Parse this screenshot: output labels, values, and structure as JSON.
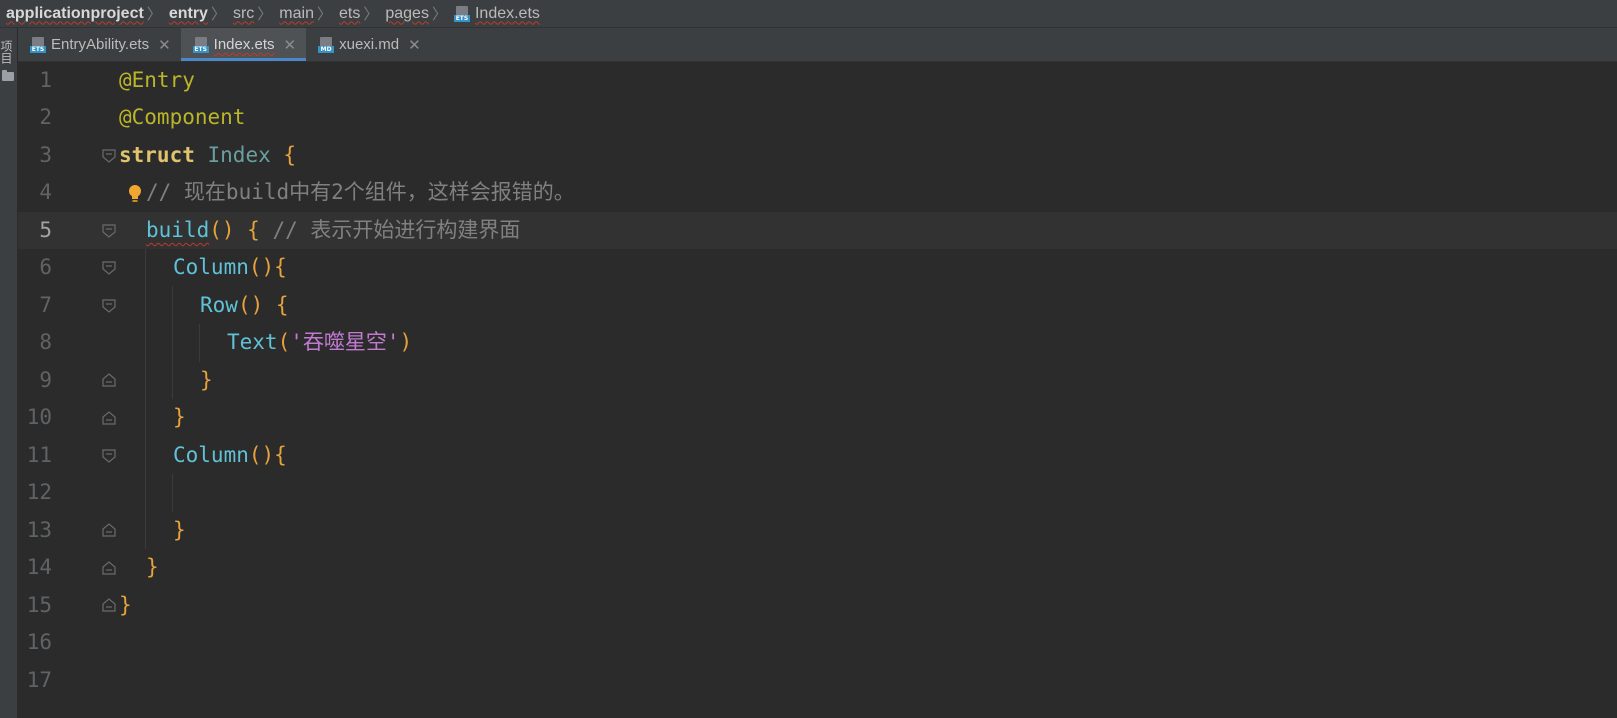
{
  "breadcrumb": {
    "items": [
      "applicationproject",
      "entry",
      "src",
      "main",
      "ets",
      "pages",
      "Index.ets"
    ]
  },
  "side_strip": {
    "label": "项目"
  },
  "tabs": [
    {
      "label": "EntryAbility.ets",
      "icon": "ETS",
      "active": false
    },
    {
      "label": "Index.ets",
      "icon": "ETS",
      "active": true
    },
    {
      "label": "xuexi.md",
      "icon": "MD",
      "active": false
    }
  ],
  "editor": {
    "current_line": 5,
    "line_numbers": [
      "1",
      "2",
      "3",
      "4",
      "5",
      "6",
      "7",
      "8",
      "9",
      "10",
      "11",
      "12",
      "13",
      "14",
      "15",
      "16",
      "17"
    ],
    "lines": {
      "l1": {
        "annot": "@Entry"
      },
      "l2": {
        "annot": "@Component"
      },
      "l3": {
        "kw": "struct",
        "name": "Index",
        "brace": "{"
      },
      "l4": {
        "comment": "// 现在build中有2个组件，这样会报错的。"
      },
      "l5": {
        "fn": "build",
        "paren": "()",
        "brace": "{",
        "comment": "// 表示开始进行构建界面"
      },
      "l6": {
        "fn": "Column",
        "paren": "()",
        "brace": "{"
      },
      "l7": {
        "fn": "Row",
        "paren": "()",
        "brace": "{"
      },
      "l8": {
        "fn": "Text",
        "open": "(",
        "str": "'吞噬星空'",
        "close": ")"
      },
      "l9": {
        "brace": "}"
      },
      "l10": {
        "brace": "}"
      },
      "l11": {
        "fn": "Column",
        "paren": "()",
        "brace": "{"
      },
      "l13": {
        "brace": "}"
      },
      "l14": {
        "brace": "}"
      },
      "l15": {
        "brace": "}"
      }
    }
  },
  "colors": {
    "background": "#2b2b2b",
    "annotation": "#bbb529",
    "keyword": "#e8bf6a",
    "function": "#5fc2d6",
    "string": "#c07ad0",
    "comment": "#808080",
    "brace": "#e6a23c"
  }
}
